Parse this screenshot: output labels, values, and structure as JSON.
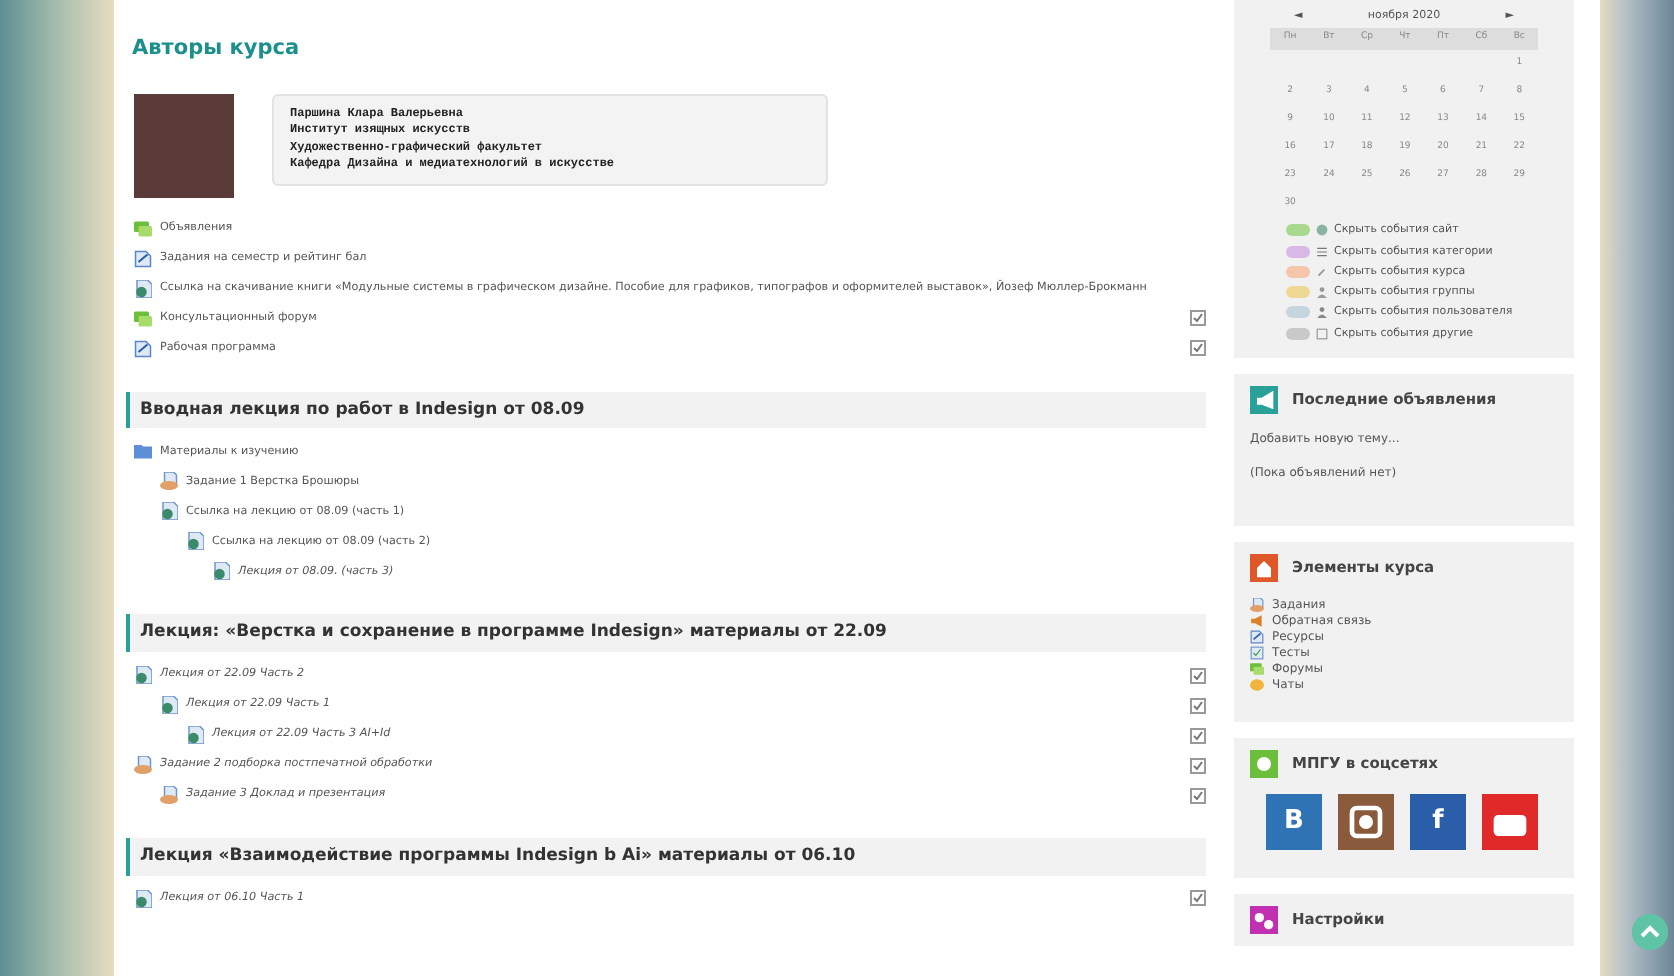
{
  "authors": {
    "title": "Авторы курса",
    "lines": [
      "Паршина Клара Валерьевна",
      "Институт изящных искусств",
      "Художественно-графический факультет",
      "Кафедра Дизайна и медиатехнологий в искусстве"
    ]
  },
  "intro_items": [
    {
      "kind": "forum",
      "label": "Объявления",
      "italic": false
    },
    {
      "kind": "page",
      "label": "Задания на семестр и рейтинг бал",
      "italic": false
    },
    {
      "kind": "url",
      "label": "Ссылка на скачивание книги «Модульные системы в графическом дизайне. Пособие для графиков, типографов и оформителей выставок», Йозеф Мюллер-Брокманн",
      "italic": false
    },
    {
      "kind": "forum",
      "label": "Консультационный форум",
      "italic": false,
      "checkbox": {
        "checked": true
      }
    },
    {
      "kind": "page",
      "label": "Рабочая программа",
      "italic": false,
      "checkbox": {
        "checked": true
      }
    }
  ],
  "sections": [
    {
      "title": "Вводная лекция по работ в Indesign от 08.09",
      "items": [
        {
          "kind": "folder",
          "label": "Материалы к изучению",
          "italic": false,
          "children": [
            {
              "kind": "assign",
              "label": "Задание 1 Верстка Брошюры",
              "italic": false
            },
            {
              "kind": "url",
              "label": "Ссылка на лекцию от 08.09 (часть 1)",
              "italic": false,
              "children": [
                {
                  "kind": "url",
                  "label": "Ссылка на лекцию от 08.09 (часть 2)",
                  "italic": false,
                  "children": [
                    {
                      "kind": "url",
                      "label": "Лекция от 08.09. (часть 3)",
                      "italic": true
                    }
                  ]
                }
              ]
            }
          ]
        }
      ]
    },
    {
      "title": "Лекция: «Верстка и сохранение в программе Indesign» материалы от 22.09",
      "items": [
        {
          "kind": "url",
          "label": "Лекция от 22.09 Часть 2",
          "italic": true,
          "checkbox": {
            "checked": true
          },
          "children": [
            {
              "kind": "url",
              "label": "Лекция от 22.09 Часть 1",
              "italic": true,
              "checkbox": {
                "checked": true
              },
              "children": [
                {
                  "kind": "url",
                  "label": "Лекция от 22.09 Часть 3 AI+Id",
                  "italic": true,
                  "checkbox": {
                    "checked": true
                  }
                }
              ]
            }
          ]
        },
        {
          "kind": "assign",
          "label": "Задание 2 подборка постпечатной обработки",
          "italic": true,
          "checkbox": {
            "checked": true
          },
          "children": [
            {
              "kind": "assign",
              "label": "Задание 3 Доклад и презентация",
              "italic": true,
              "checkbox": {
                "checked": true
              }
            }
          ]
        }
      ]
    },
    {
      "title": "Лекция «Взаимодействие программы Indesign b Ai» материалы от 06.10",
      "items": [
        {
          "kind": "url",
          "label": "Лекция от 06.10 Часть 1",
          "italic": true,
          "checkbox": {
            "checked": true
          }
        }
      ]
    }
  ],
  "calendar": {
    "prev": "◄",
    "month": "ноября 2020",
    "next": "►",
    "weekdays": [
      "Пн",
      "Вт",
      "Ср",
      "Чт",
      "Пт",
      "Сб",
      "Вс"
    ],
    "weeks": [
      [
        "1"
      ],
      [
        "2",
        "3",
        "4",
        "5",
        "6",
        "7",
        "8"
      ],
      [
        "9",
        "10",
        "11",
        "12",
        "13",
        "14",
        "15"
      ],
      [
        "16",
        "17",
        "18",
        "19",
        "20",
        "21",
        "22"
      ],
      [
        "23",
        "24",
        "25",
        "26",
        "27",
        "28",
        "29"
      ],
      [
        "30"
      ]
    ],
    "filters": [
      {
        "kind": "site",
        "label": "Скрыть события сайт",
        "color": "#a9d98e"
      },
      {
        "kind": "category",
        "label": "Скрыть события категории",
        "color": "#d9b8e6"
      },
      {
        "kind": "course",
        "label": "Скрыть события курса",
        "color": "#f5c6ab"
      },
      {
        "kind": "group",
        "label": "Скрыть события группы",
        "color": "#efd894"
      },
      {
        "kind": "user",
        "label": "Скрыть события пользователя",
        "color": "#c7d6de"
      },
      {
        "kind": "other",
        "label": "Скрыть события другие",
        "color": "#c9c9c9"
      }
    ]
  },
  "blocks": [
    {
      "kind": "news",
      "title": "Последние объявления",
      "links": [
        "Добавить новую тему..."
      ],
      "note": "(Пока объявлений нет)"
    },
    {
      "kind": "elements",
      "title": "Элементы курса",
      "items": [
        {
          "kind": "assign",
          "label": "Задания"
        },
        {
          "kind": "feedback",
          "label": "Обратная связь"
        },
        {
          "kind": "page",
          "label": "Ресурсы"
        },
        {
          "kind": "quiz",
          "label": "Тесты"
        },
        {
          "kind": "forum",
          "label": "Форумы"
        },
        {
          "kind": "chat",
          "label": "Чаты"
        }
      ]
    },
    {
      "kind": "social",
      "title": "МПГУ в соцсетях",
      "buttons": [
        {
          "kind": "letter",
          "text": "В"
        },
        {
          "kind": "camera"
        },
        {
          "kind": "letter",
          "text": "f"
        },
        {
          "kind": "video"
        }
      ]
    },
    {
      "kind": "settings",
      "title": "Настройки"
    }
  ]
}
